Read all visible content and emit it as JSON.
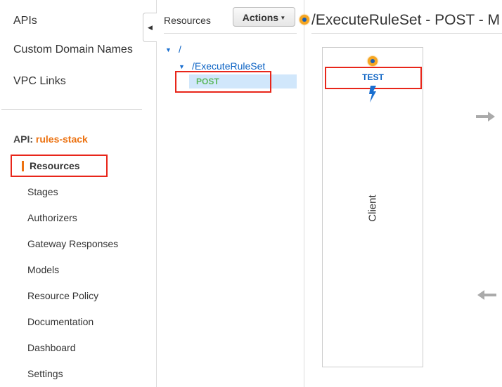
{
  "sidebar": {
    "top_items": [
      "APIs",
      "Custom Domain Names",
      "VPC Links"
    ],
    "api_label": "API:",
    "api_name": "rules-stack",
    "sub_items": [
      "Resources",
      "Stages",
      "Authorizers",
      "Gateway Responses",
      "Models",
      "Resource Policy",
      "Documentation",
      "Dashboard",
      "Settings"
    ]
  },
  "resources_panel": {
    "title": "Resources",
    "actions_label": "Actions",
    "tree": {
      "root": "/",
      "child": "/ExecuteRuleSet",
      "method": "POST"
    }
  },
  "main": {
    "title": "/ExecuteRuleSet - POST - M",
    "test_label": "TEST",
    "client_label": "Client"
  },
  "colors": {
    "accent": "#ec7211",
    "link": "#0c63c4",
    "method": "#5cb85c",
    "highlight": "#d1e7fb",
    "annotation": "#e8261a"
  }
}
